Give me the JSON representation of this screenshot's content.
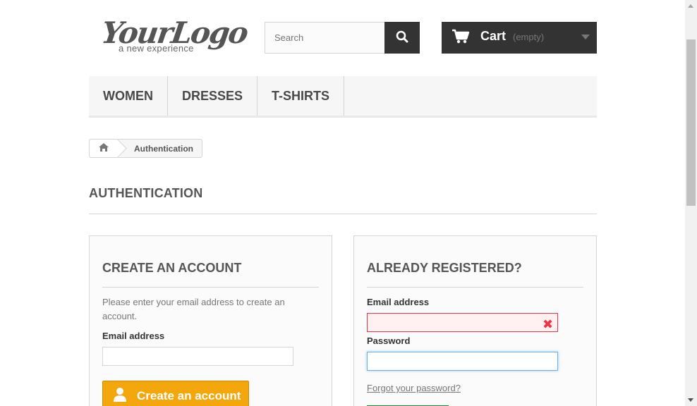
{
  "header": {
    "logo": {
      "main": "YourLogo",
      "tagline": "a new experience"
    },
    "search": {
      "placeholder": "Search",
      "icon": "search-icon"
    },
    "cart": {
      "title": "Cart",
      "status": "(empty)",
      "icon": "shopping-cart-icon"
    }
  },
  "topnav": {
    "items": [
      "WOMEN",
      "DRESSES",
      "T-SHIRTS"
    ]
  },
  "breadcrumb": {
    "home_icon": "home-icon",
    "current": "Authentication"
  },
  "page": {
    "heading": "AUTHENTICATION"
  },
  "create_account": {
    "title": "CREATE AN ACCOUNT",
    "description": "Please enter your email address to create an account.",
    "email_label": "Email address",
    "email_value": "",
    "button_label": "Create an account",
    "button_icon": "user-icon"
  },
  "login": {
    "title": "ALREADY REGISTERED?",
    "email_label": "Email address",
    "email_value": "",
    "email_error_icon": "error-x-icon",
    "password_label": "Password",
    "password_value": "",
    "forgot_link": "Forgot your password?"
  },
  "colors": {
    "dark": "#333333",
    "accent_orange": "#f4a70d",
    "error_red": "#f13340",
    "focus_blue": "#66afe9",
    "signin_green": "#43b155"
  }
}
